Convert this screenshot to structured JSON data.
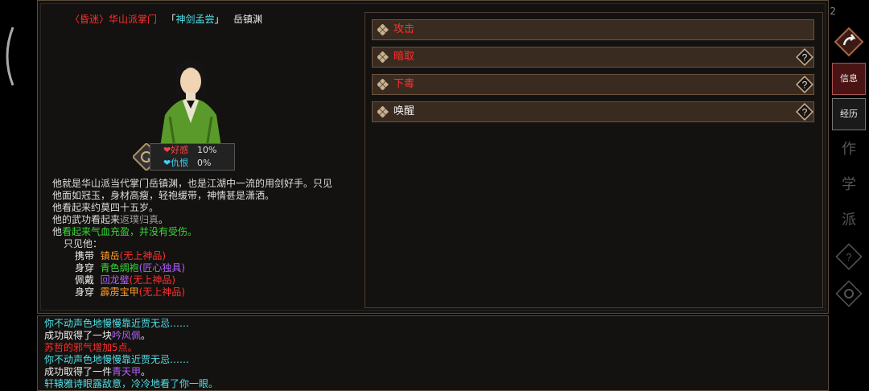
{
  "header": {
    "lb": "〈",
    "status": "昏迷",
    "rb": "〉",
    "sect": "华山派掌门",
    "title_open": "「",
    "title": "神剑孟尝",
    "title_close": "」",
    "name": "岳镇渊"
  },
  "top_right_number": "2",
  "stats": {
    "favor_label": "好感",
    "favor_value": "10%",
    "hatred_label": "仇恨",
    "hatred_value": "0%"
  },
  "description": {
    "intro": "他就是华山派当代掌门岳镇渊，也是江湖中一流的用剑好手。只见他面如冠玉，身材高瘦，轻袍缓带，神情甚是潇洒。",
    "age": "他看起来约莫四十五岁。",
    "kungfu_prefix": "他的武功看起来",
    "kungfu_level": "返璞归真",
    "kungfu_suffix": "。",
    "health_prefix": "他",
    "health": "看起来气血充盈，并没有受伤。",
    "seen": "只见他：",
    "equipment": [
      {
        "verb": "携带",
        "item": "镇岳",
        "open": "(",
        "grade": "无上神品",
        "close": ")",
        "item_color": "orange",
        "grade_color": "red"
      },
      {
        "verb": "身穿",
        "item": "青色绸袍",
        "open": "(",
        "grade": "匠心独具",
        "close": ")",
        "item_color": "green",
        "grade_color": "purple"
      },
      {
        "verb": "佩戴",
        "item": "回龙璧",
        "open": "(",
        "grade": "无上神品",
        "close": ")",
        "item_color": "purple",
        "grade_color": "red"
      },
      {
        "verb": "身穿",
        "item": "霹雳宝甲",
        "open": "(",
        "grade": "无上神品",
        "close": ")",
        "item_color": "orange",
        "grade_color": "red"
      }
    ]
  },
  "actions": [
    {
      "label": "攻击",
      "color": "#ff3030",
      "help": false
    },
    {
      "label": "暗取",
      "color": "#ff3030",
      "help": true
    },
    {
      "label": "下毒",
      "color": "#ff3030",
      "help": true
    },
    {
      "label": "唤醒",
      "color": "#eeeeee",
      "help": true
    }
  ],
  "side": {
    "info": "信息",
    "history": "经历",
    "ghost1": "作",
    "ghost2": "学",
    "ghost3": "派"
  },
  "log": [
    {
      "parts": [
        {
          "t": "你不动声色地慢慢靠近贾无忌……",
          "c": "cyan"
        }
      ]
    },
    {
      "parts": [
        {
          "t": "成功取得了一块",
          "c": "white"
        },
        {
          "t": "吟风佩",
          "c": "purple"
        },
        {
          "t": "。",
          "c": "white"
        }
      ]
    },
    {
      "parts": [
        {
          "t": "苏哲的邪气增加5点。",
          "c": "red"
        }
      ]
    },
    {
      "parts": [
        {
          "t": "你不动声色地慢慢靠近贾无忌……",
          "c": "cyan"
        }
      ]
    },
    {
      "parts": [
        {
          "t": "成功取得了一件",
          "c": "white"
        },
        {
          "t": "青天甲",
          "c": "purple"
        },
        {
          "t": "。",
          "c": "white"
        }
      ]
    },
    {
      "parts": [
        {
          "t": "轩辕雅诗眼露敌意，冷冷地看了你一眼。",
          "c": "cyan"
        }
      ]
    }
  ]
}
